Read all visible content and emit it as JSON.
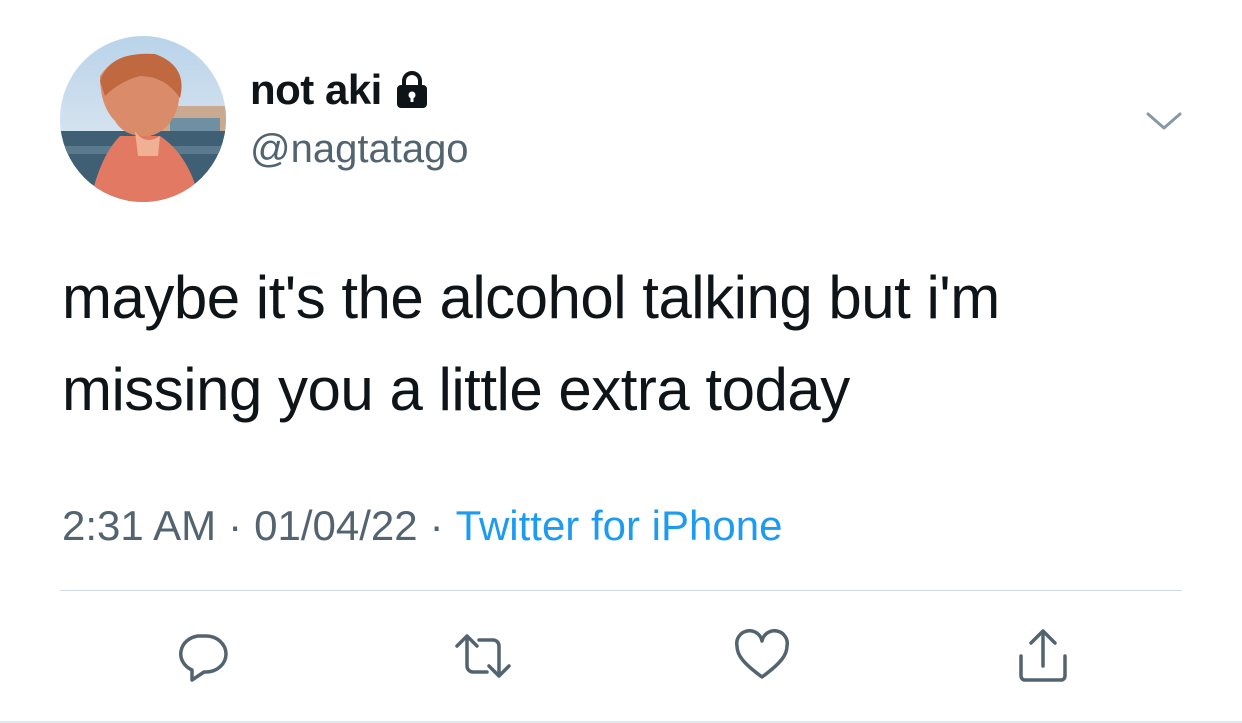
{
  "author": {
    "display_name": "not aki",
    "handle": "@nagtatago",
    "protected_icon": "lock-icon",
    "avatar_alt": "profile photo"
  },
  "tweet": {
    "text": "maybe it's the alcohol talking but i'm missing you a little extra today",
    "time": "2:31 AM",
    "date": "01/04/22",
    "separator": "·",
    "source": "Twitter for iPhone"
  },
  "actions": [
    {
      "name": "reply",
      "icon": "reply-icon"
    },
    {
      "name": "retweet",
      "icon": "retweet-icon"
    },
    {
      "name": "like",
      "icon": "heart-icon"
    },
    {
      "name": "share",
      "icon": "share-icon"
    }
  ],
  "colors": {
    "text": "#0f1419",
    "secondary": "#536471",
    "link": "#1d9bf0",
    "divider": "#cfd9de"
  }
}
